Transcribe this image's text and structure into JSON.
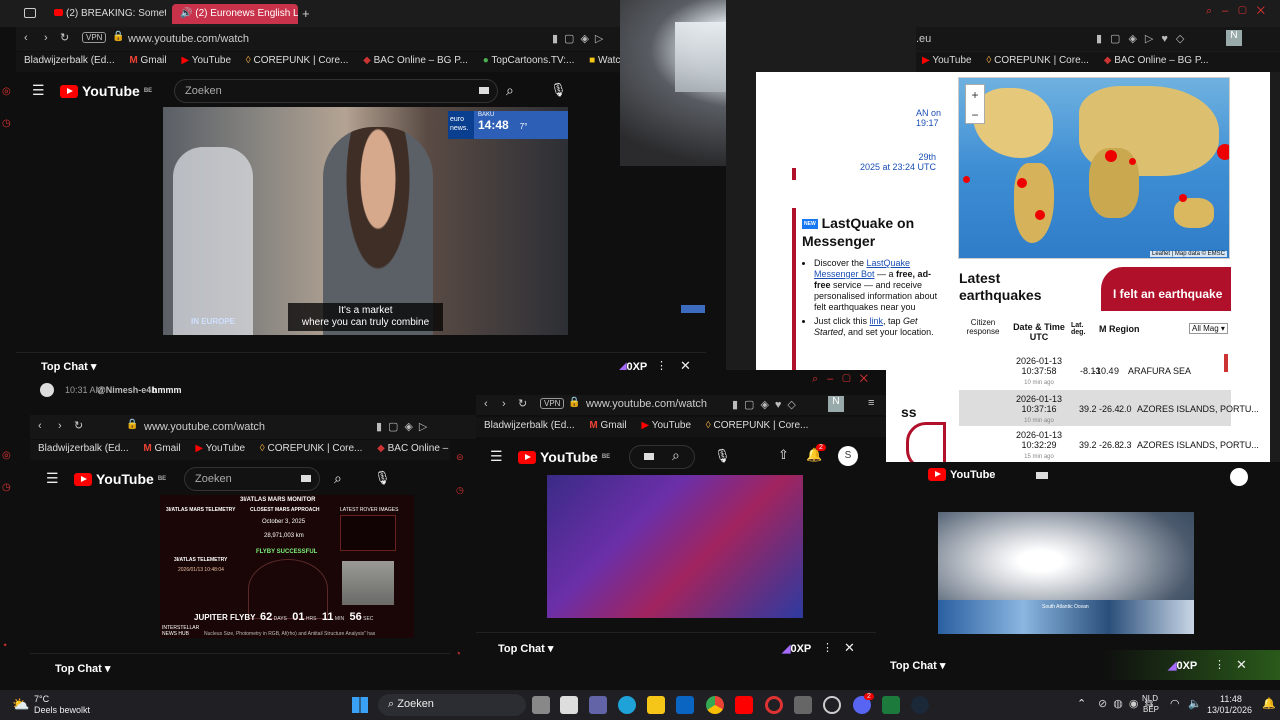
{
  "browser_main": {
    "tabs": [
      {
        "label": "(2) BREAKING: Something"
      },
      {
        "label": "(2) Euronews English L"
      }
    ],
    "url": "www.youtube.com/watch",
    "vpn": "VPN",
    "bookmarks": [
      "Bladwijzerbalk (Ed...",
      "Gmail",
      "YouTube",
      "COREPUNK | Core...",
      "BAC Online – BG P...",
      "TopCartoons.TV:...",
      "Watch Sci-Fi Cart"
    ]
  },
  "yt_main": {
    "logo": "YouTube",
    "region": "BE",
    "search_placeholder": "Zoeken",
    "overlay_city": "BAKU",
    "overlay_time": "14:48",
    "overlay_temp": "7°",
    "overlay_brand": "euro news.",
    "subtitle_line1": "It's a market",
    "subtitle_line2": "where you can truly combine",
    "show_logo": "IN EUROPE",
    "chat_label": "Top Chat",
    "xp": "0XP",
    "chat_time": "10:31 AM",
    "chat_user": "@Nimesh-e4b",
    "chat_msg": "hmmm"
  },
  "emsc": {
    "url_fragment": ".eu",
    "bookmarks": [
      "YouTube",
      "COREPUNK | Core...",
      "BAC Online – BG P..."
    ],
    "left_links": [
      "AN on",
      "19:17",
      "29th",
      "2025 at 23:24 UTC"
    ],
    "new_badge": "NEW",
    "messenger_title": "LastQuake on Messenger",
    "bullet1_pre": "Discover the ",
    "bullet1_link": "LastQuake Messenger Bot",
    "bullet1_mid": " — a ",
    "bullet1_bold": "free, ad-free",
    "bullet1_post": " service — and receive personalised information about felt earthquakes near you",
    "bullet2_pre": "Just click this ",
    "bullet2_link": "link",
    "bullet2_mid": ", tap ",
    "bullet2_em": "Get Started",
    "bullet2_post": ", and set your location.",
    "ss": "ss",
    "map_plus": "+",
    "map_minus": "−",
    "map_credit": "Leaflet | Map data © EMSC",
    "latest_title": "Latest earthquakes",
    "felt_button": "I felt an earthquake",
    "col_citizen": "Citizen response",
    "col_date": "Date & Time UTC",
    "col_lat": "Lat. deg.",
    "col_mag": "M",
    "col_region": "Region",
    "filter": "All Mag",
    "rows": [
      {
        "date": "2026-01-13",
        "time": "10:37:58",
        "ago": "10 min ago",
        "lat": "-8.13",
        "lon": "-10.4",
        "mag": "9",
        "region": "ARAFURA SEA"
      },
      {
        "date": "2026-01-13",
        "time": "10:37:16",
        "ago": "10 min ago",
        "lat": "39.2",
        "lon": "-26.4",
        "mag": "2.0",
        "region": "AZORES ISLANDS, PORTU..."
      },
      {
        "date": "2026-01-13",
        "time": "10:32:29",
        "ago": "15 min ago",
        "lat": "39.2",
        "lon": "-26.8",
        "mag": "2.3",
        "region": "AZORES ISLANDS, PORTU..."
      },
      {
        "date": "2026-01-13",
        "time": "",
        "ago": "",
        "lat": "",
        "lon": "",
        "mag": "",
        "region": ""
      }
    ]
  },
  "yt_bl": {
    "url": "www.youtube.com/watch",
    "bookmarks": [
      "Bladwijzerbalk (Ed...",
      "Gmail",
      "YouTube",
      "COREPUNK | Core...",
      "BAC Online – BG P..."
    ],
    "logo": "YouTube",
    "region": "BE",
    "search_placeholder": "Zoeken",
    "monitor_title": "3I/ATLAS MARS MONITOR",
    "mars_telemetry": "3I/ATLAS MARS TELEMETRY",
    "closest_approach": "CLOSEST MARS APPROACH",
    "latest_rover": "LATEST ROVER IMAGES",
    "approach_date": "October 3, 2025",
    "approach_km": "28,971,003 km",
    "flyby_status": "FLYBY SUCCESSFUL",
    "atlas_telemetry": "3I/ATLAS TELEMETRY",
    "tel_date": "2026/01/13 10:48:04",
    "jupiter": "JUPITER FLYBY",
    "days": "62",
    "days_label": "DAYS",
    "hours": "01",
    "hours_label": "HRS",
    "mins": "11",
    "mins_label": "MIN",
    "secs": "56",
    "secs_label": "SEC",
    "ticker": "Nucleus Size, Photometry in RGB, Af(rho) and Antitail Structure Analysis\" has",
    "brand": "INTERSTELLAR NEWS HUB",
    "chat_label": "Top Chat"
  },
  "yt_bc": {
    "url": "www.youtube.com/watch",
    "vpn": "VPN",
    "bookmarks": [
      "Bladwijzerbalk (Ed...",
      "Gmail",
      "YouTube",
      "COREPUNK | Core..."
    ],
    "logo": "YouTube",
    "region": "BE",
    "avatar": "S",
    "profile_badge": "N",
    "notif": "2",
    "chat_label": "Top Chat",
    "xp": "0XP"
  },
  "yt_br": {
    "logo": "YouTube",
    "map_label": "South Atlantic Ocean",
    "chat_label": "Top Chat",
    "xp": "0XP"
  },
  "taskbar": {
    "weather_temp": "7°C",
    "weather_desc": "Deels bewolkt",
    "search": "Zoeken",
    "lang1": "NLD",
    "lang2": "BEP",
    "time": "11:48",
    "date": "13/01/2026",
    "discord_badge": "2"
  }
}
